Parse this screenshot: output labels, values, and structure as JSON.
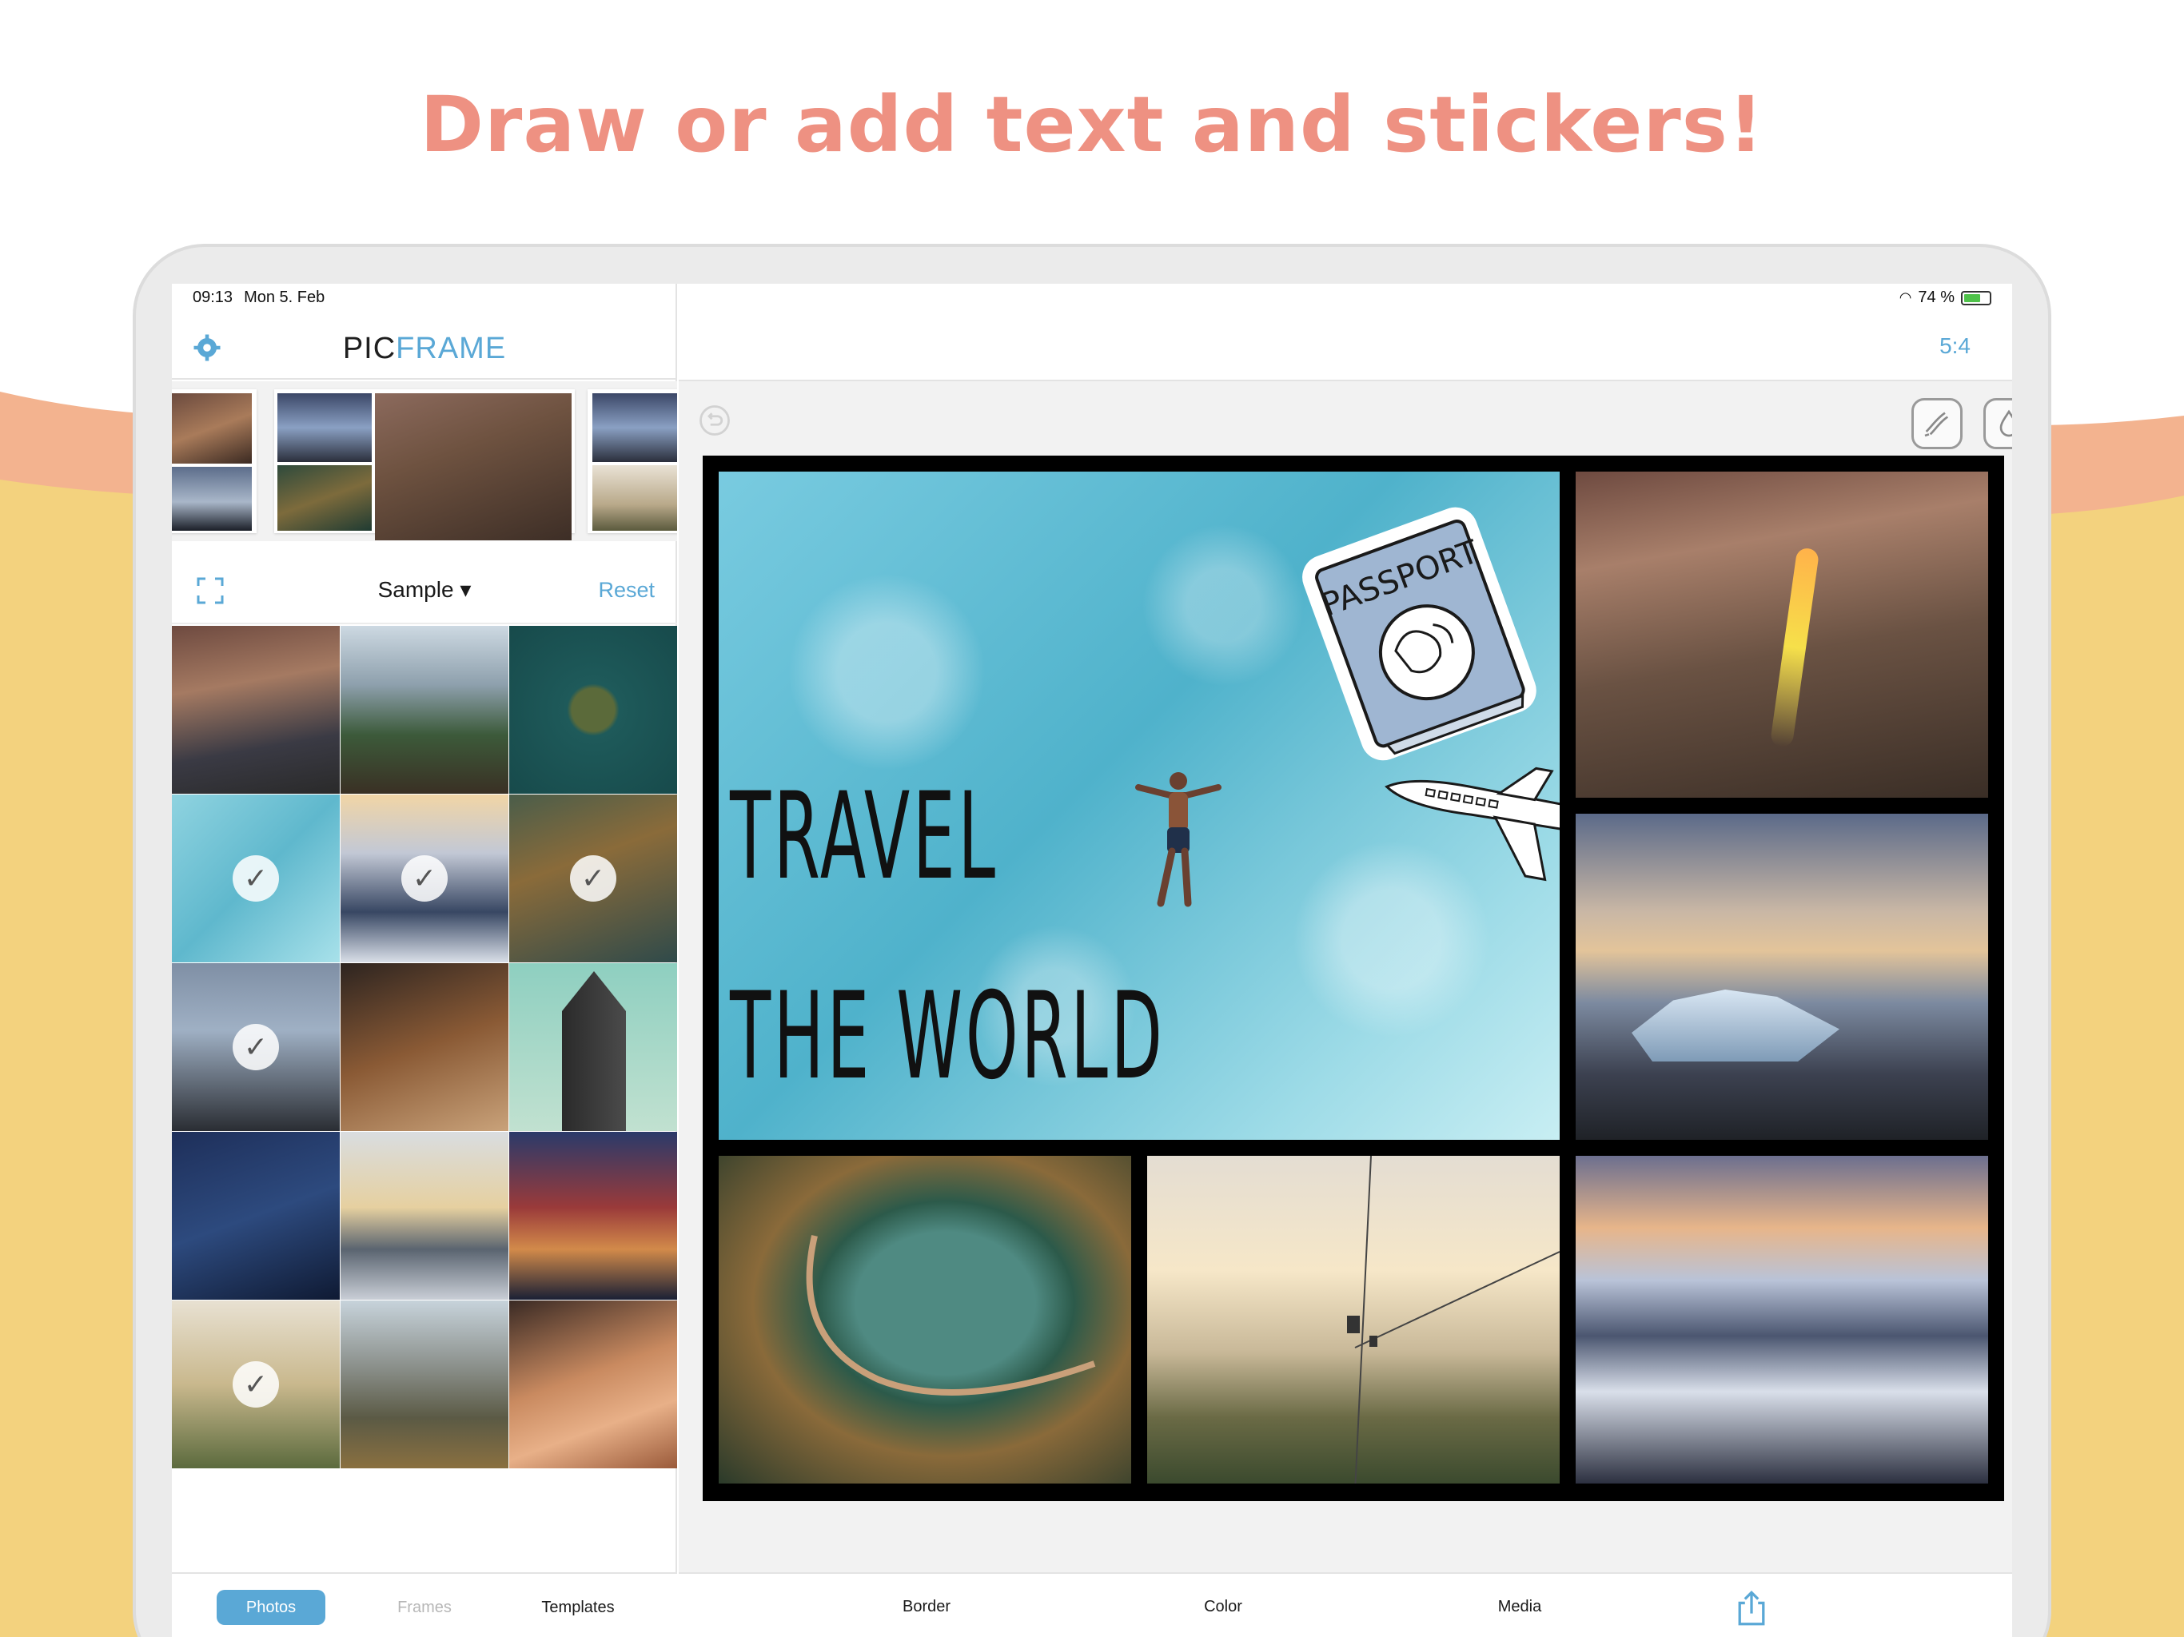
{
  "headline": "Draw or add text and stickers!",
  "status": {
    "time": "09:13",
    "date": "Mon 5. Feb",
    "battery": "74 %"
  },
  "app": {
    "logo_part1": "PIC",
    "logo_part2": "FRAME",
    "ratio": "5:4"
  },
  "library": {
    "album": "Sample ▾",
    "reset": "Reset"
  },
  "tabs_left": [
    "Photos",
    "Frames",
    "Templates"
  ],
  "tabs_right": [
    "Border",
    "Color",
    "Media"
  ],
  "canvas": {
    "line1": "TRAVEL",
    "line2": "THE WORLD",
    "sticker1": "PASSPORT"
  },
  "colors": {
    "accent": "#5aa8d6",
    "headline": "#ee9182",
    "wave_orange": "#f3b38f",
    "wave_yellow": "#f3d27e"
  },
  "icons": [
    "gear-icon",
    "fullscreen-icon",
    "undo-icon",
    "brush-icon",
    "drop-icon",
    "text-icon",
    "sticker-icon",
    "share-icon"
  ]
}
